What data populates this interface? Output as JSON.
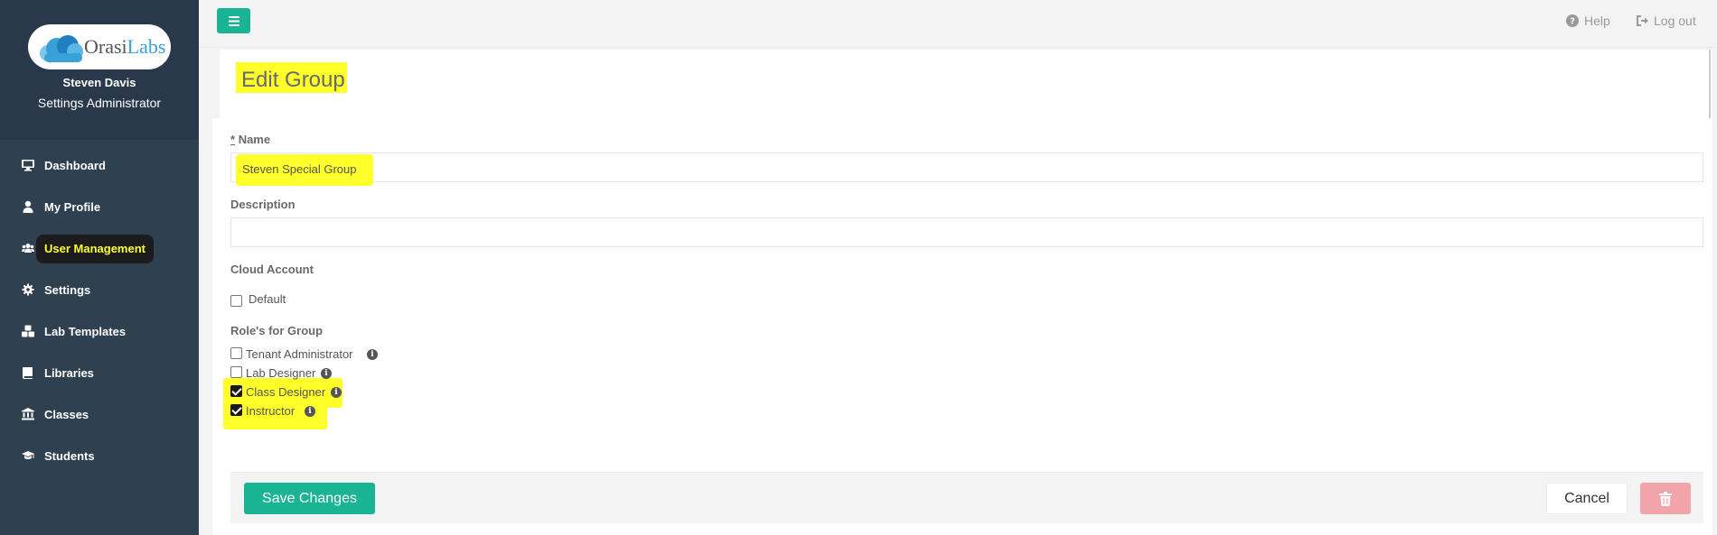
{
  "sidebar": {
    "logo": {
      "text_dark": "Orasi",
      "text_blue": "Labs"
    },
    "user_name": "Steven Davis",
    "user_role": "Settings Administrator",
    "items": [
      {
        "label": "Dashboard",
        "icon": "desktop-icon"
      },
      {
        "label": "My Profile",
        "icon": "user-icon"
      },
      {
        "label": "User Management",
        "icon": "users-icon",
        "active": true
      },
      {
        "label": "Settings",
        "icon": "gear-icon"
      },
      {
        "label": "Lab Templates",
        "icon": "cubes-icon"
      },
      {
        "label": "Libraries",
        "icon": "book-icon"
      },
      {
        "label": "Classes",
        "icon": "university-icon"
      },
      {
        "label": "Students",
        "icon": "graduation-cap-icon"
      }
    ]
  },
  "topbar": {
    "help_label": "Help",
    "logout_label": "Log out"
  },
  "page": {
    "title": "Edit Group"
  },
  "form": {
    "name_required_marker": "*",
    "name_label": "Name",
    "name_value": "Steven Special Group",
    "description_label": "Description",
    "description_value": "",
    "cloud_account_label": "Cloud Account",
    "cloud_account_option": "Default",
    "roles_label": "Role's for Group",
    "roles": [
      {
        "label": "Tenant Administrator",
        "checked": false
      },
      {
        "label": "Lab Designer",
        "checked": false
      },
      {
        "label": "Class Designer",
        "checked": true
      },
      {
        "label": "Instructor",
        "checked": true
      }
    ]
  },
  "footer": {
    "save_label": "Save Changes",
    "cancel_label": "Cancel"
  },
  "colors": {
    "sidebar_bg": "#2f4050",
    "accent": "#1ab394",
    "highlight": "#ffff2a",
    "danger_light": "#f1a4a9"
  }
}
